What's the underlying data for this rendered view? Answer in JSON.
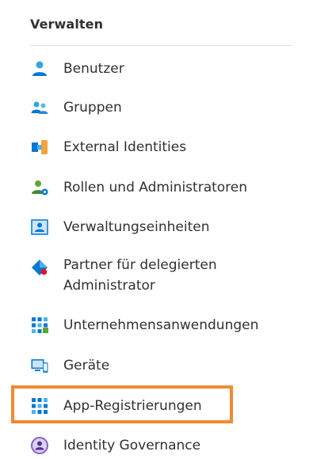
{
  "section": {
    "title": "Verwalten"
  },
  "items": [
    {
      "label": "Benutzer",
      "icon": "user-icon"
    },
    {
      "label": "Gruppen",
      "icon": "group-icon"
    },
    {
      "label": "External Identities",
      "icon": "external-identities-icon"
    },
    {
      "label": "Rollen und Administratoren",
      "icon": "roles-admins-icon"
    },
    {
      "label": "Verwaltungseinheiten",
      "icon": "admin-units-icon"
    },
    {
      "label": "Partner für delegierten Administrator",
      "icon": "partner-delegated-admin-icon"
    },
    {
      "label": "Unternehmensanwendungen",
      "icon": "enterprise-apps-icon"
    },
    {
      "label": "Geräte",
      "icon": "devices-icon"
    },
    {
      "label": "App-Registrierungen",
      "icon": "app-registrations-icon",
      "highlighted": true
    },
    {
      "label": "Identity Governance",
      "icon": "identity-governance-icon"
    }
  ],
  "colors": {
    "highlight_border": "#f28a30",
    "icon_blue": "#0078d4",
    "icon_green": "#5ea832",
    "text": "#323130"
  }
}
